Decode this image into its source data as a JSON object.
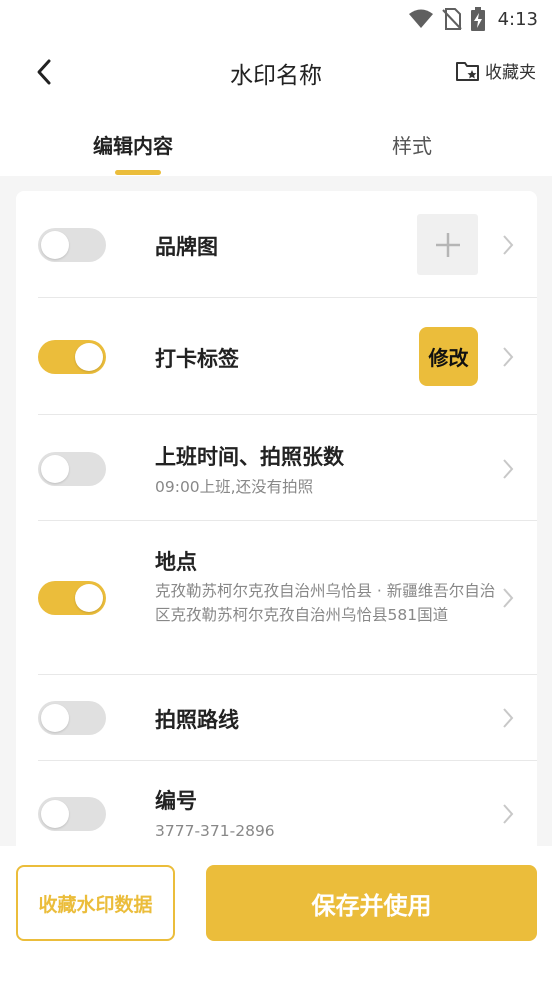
{
  "status_bar": {
    "time": "4:13"
  },
  "header": {
    "title": "水印名称",
    "favorites_label": "收藏夹"
  },
  "tabs": [
    {
      "label": "编辑内容",
      "active": true
    },
    {
      "label": "样式",
      "active": false
    }
  ],
  "rows": [
    {
      "title": "品牌图",
      "enabled": false
    },
    {
      "title": "打卡标签",
      "enabled": true,
      "action_label": "修改"
    },
    {
      "title": "上班时间、拍照张数",
      "subtitle": "09:00上班,还没有拍照",
      "enabled": false
    },
    {
      "title": "地点",
      "subtitle": "克孜勒苏柯尔克孜自治州乌恰县 · 新疆维吾尔自治区克孜勒苏柯尔克孜自治州乌恰县581国道",
      "enabled": true
    },
    {
      "title": "拍照路线",
      "enabled": false
    },
    {
      "title": "编号",
      "subtitle": "3777-371-2896",
      "enabled": false
    }
  ],
  "bottom": {
    "save_data_label": "收藏水印数据",
    "save_use_label": "保存并使用"
  },
  "colors": {
    "accent": "#ebbd3b",
    "toggle_off": "#e0e0e0",
    "background": "#f5f5f5"
  }
}
